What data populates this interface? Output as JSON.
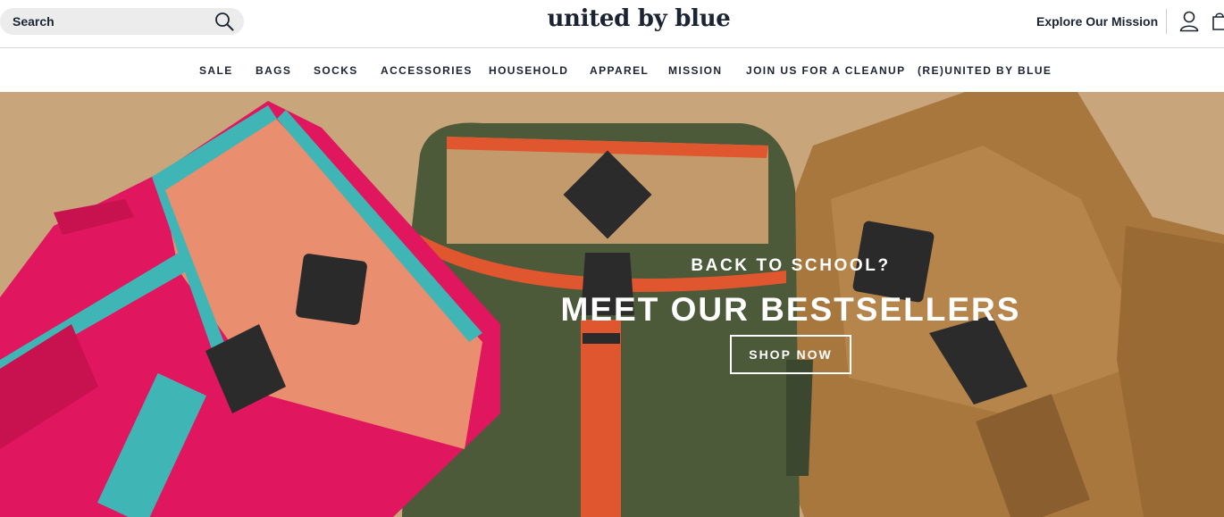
{
  "header": {
    "search": {
      "label": "Search"
    },
    "logo": "united by blue",
    "mission_link": "Explore Our Mission"
  },
  "nav": {
    "items": [
      {
        "label": "SALE"
      },
      {
        "label": "BAGS"
      },
      {
        "label": "SOCKS"
      },
      {
        "label": "ACCESSORIES"
      },
      {
        "label": "HOUSEHOLD"
      },
      {
        "label": "APPAREL"
      },
      {
        "label": "MISSION"
      },
      {
        "label": "JOIN US FOR A CLEANUP"
      },
      {
        "label": "(RE)UNITED BY BLUE"
      }
    ]
  },
  "hero": {
    "eyebrow": "BACK TO SCHOOL?",
    "title": "MEET OUR BESTSELLERS",
    "cta": "SHOP NOW"
  },
  "icons": {
    "search": "search-icon",
    "account": "account-icon",
    "cart": "cart-icon"
  },
  "colors": {
    "text": "#1b2433",
    "hero_background": "#c9a57c",
    "search_background": "#ececec"
  }
}
